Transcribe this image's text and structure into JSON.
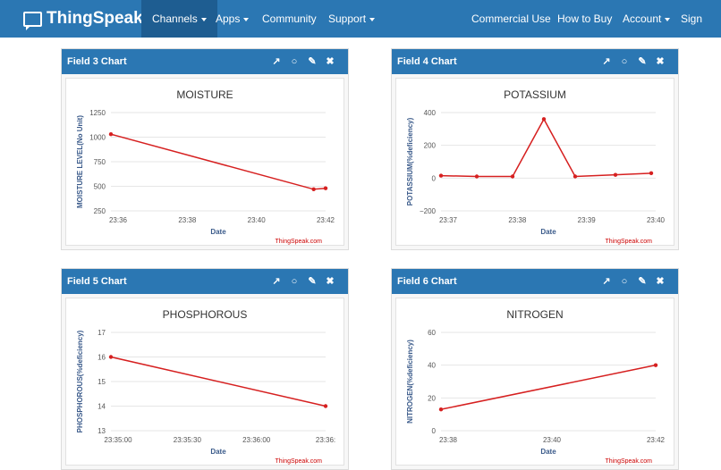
{
  "nav": {
    "brand": "ThingSpeak",
    "tm": "™",
    "channels": "Channels",
    "apps": "Apps",
    "community": "Community",
    "support": "Support",
    "commercial": "Commercial Use",
    "how_to_buy": "How to Buy",
    "account": "Account",
    "sign_out": "Sign Out"
  },
  "panels": [
    {
      "title": "Field 3 Chart"
    },
    {
      "title": "Field 4 Chart"
    },
    {
      "title": "Field 5 Chart"
    },
    {
      "title": "Field 6 Chart"
    }
  ],
  "chart_data": [
    {
      "type": "line",
      "title": "MOISTURE",
      "xlabel": "Date",
      "ylabel": "MOISTURE LEVEL(No Unit)",
      "credit": "ThingSpeak.com",
      "color": "#d62020",
      "yticks": [
        "1250",
        "1000",
        "750",
        "500",
        "250"
      ],
      "ylim": [
        250,
        1250
      ],
      "xticks": [
        "23:36",
        "23:38",
        "23:40",
        "23:42"
      ],
      "xlim": [
        "23:36",
        "23:42"
      ],
      "x": [
        "23:36",
        "23:41:40",
        "23:42"
      ],
      "y": [
        1030,
        470,
        480
      ]
    },
    {
      "type": "line",
      "title": "POTASSIUM",
      "xlabel": "Date",
      "ylabel": "POTASSIUM(%deficiency)",
      "credit": "ThingSpeak.com",
      "color": "#d62020",
      "yticks": [
        "400",
        "200",
        "0",
        "−200"
      ],
      "ylim": [
        -200,
        400
      ],
      "xticks": [
        "23:37",
        "23:38",
        "23:39",
        "23:40"
      ],
      "xlim": [
        "23:36:45",
        "23:40:45"
      ],
      "x": [
        "23:36:45",
        "23:37:25",
        "23:38:05",
        "23:38:40",
        "23:39:15",
        "23:40:00",
        "23:40:40"
      ],
      "y": [
        15,
        10,
        10,
        360,
        10,
        20,
        30
      ]
    },
    {
      "type": "line",
      "title": "PHOSPHOROUS",
      "xlabel": "Date",
      "ylabel": "PHOSPHOROUS(%deficiency)",
      "credit": "ThingSpeak.com",
      "color": "#d62020",
      "yticks": [
        "17",
        "16",
        "15",
        "14",
        "13"
      ],
      "ylim": [
        13,
        17
      ],
      "xticks": [
        "23:35:00",
        "23:35:30",
        "23:36:00",
        "23:36:"
      ],
      "xlim": [
        "23:34:40",
        "23:36:30"
      ],
      "x": [
        "23:34:40",
        "23:36:30"
      ],
      "y": [
        16,
        14
      ]
    },
    {
      "type": "line",
      "title": "NITROGEN",
      "xlabel": "Date",
      "ylabel": "NITROGEN(%deficiency)",
      "credit": "ThingSpeak.com",
      "color": "#d62020",
      "yticks": [
        "60",
        "40",
        "20",
        "0"
      ],
      "ylim": [
        0,
        60
      ],
      "xticks": [
        "23:38",
        "23:40",
        "23:42"
      ],
      "xlim": [
        "23:35:20",
        "23:42"
      ],
      "x": [
        "23:35:20",
        "23:42"
      ],
      "y": [
        13,
        40
      ]
    }
  ]
}
